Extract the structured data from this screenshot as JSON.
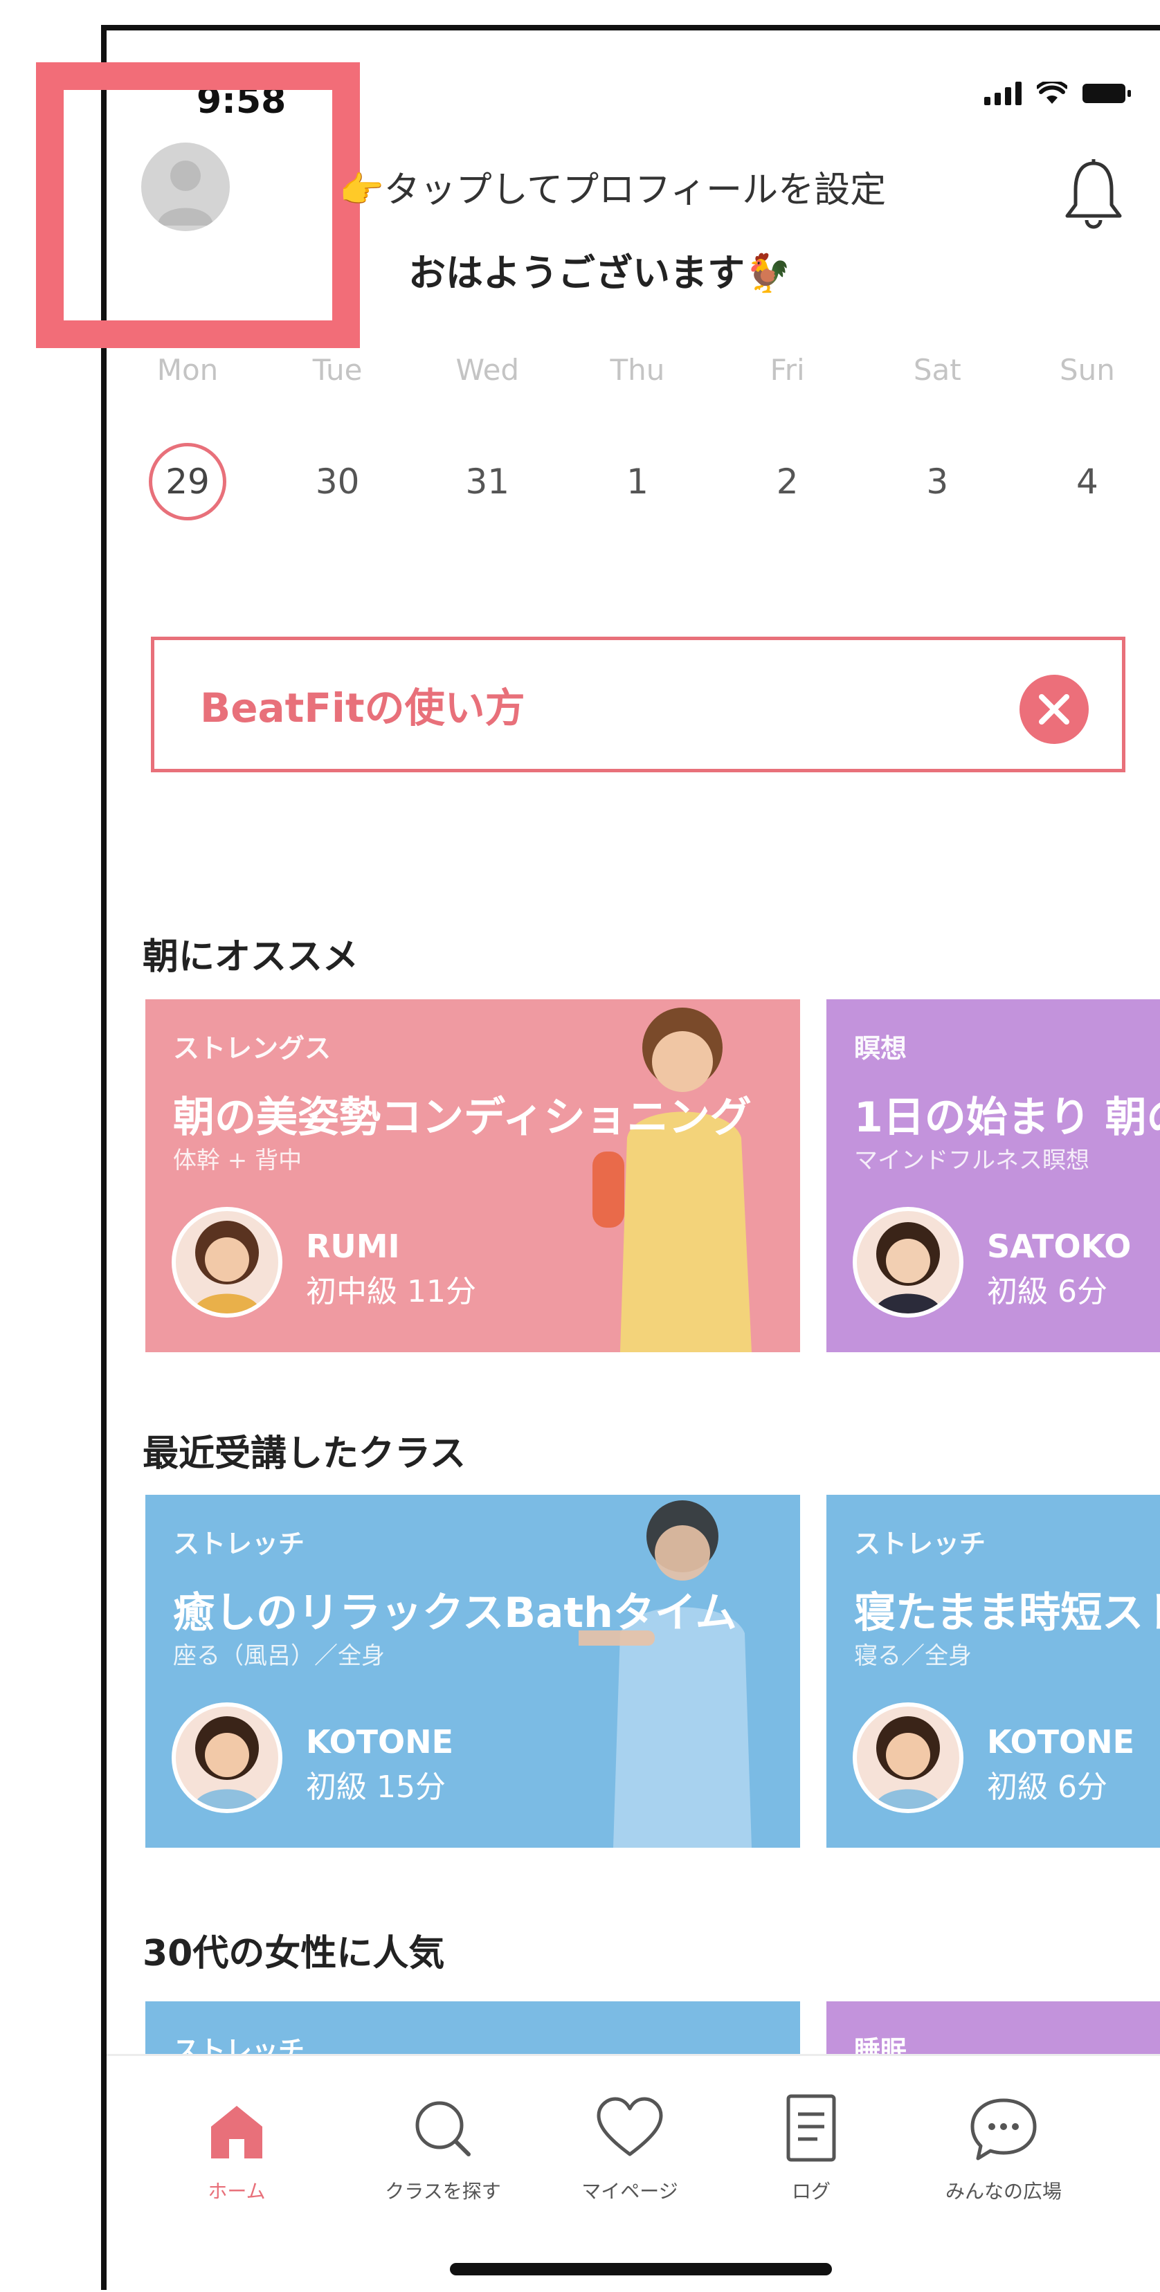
{
  "colors": {
    "accent": "#e8707a",
    "card_pink": "#ef9aa1",
    "card_purple": "#c393dc",
    "card_blue": "#7bbbe4",
    "highlight_box": "#f26d78"
  },
  "status_bar": {
    "time": "9:58",
    "icons": [
      "signal-icon",
      "wifi-icon",
      "battery-icon"
    ]
  },
  "header": {
    "profile_prompt": "👉タップしてプロフィールを設定",
    "greeting": "おはようございます🐓",
    "avatar_icon": "user-avatar-icon",
    "bell_icon": "bell-icon"
  },
  "calendar": {
    "weekdays": [
      "Mon",
      "Tue",
      "Wed",
      "Thu",
      "Fri",
      "Sat",
      "Sun"
    ],
    "dates": [
      "29",
      "30",
      "31",
      "1",
      "2",
      "3",
      "4"
    ],
    "selected": "29"
  },
  "howto_banner": {
    "text": "BeatFitの使い方"
  },
  "sections": [
    {
      "title": "朝にオススメ",
      "cards": [
        {
          "category": "ストレングス",
          "title": "朝の美姿勢コンディショニング",
          "subtitle": "体幹 + 背中",
          "instructor": "RUMI",
          "meta": "初中級 11分"
        },
        {
          "category": "瞑想",
          "title": "1日の始まり 朝の",
          "subtitle": "マインドフルネス瞑想",
          "instructor": "SATOKO",
          "meta": "初級 6分"
        }
      ]
    },
    {
      "title": "最近受講したクラス",
      "cards": [
        {
          "category": "ストレッチ",
          "title": "癒しのリラックスBathタイム",
          "subtitle": "座る（風呂）／全身",
          "instructor": "KOTONE",
          "meta": "初級 15分"
        },
        {
          "category": "ストレッチ",
          "title": "寝たまま時短スト",
          "subtitle": "寝る／全身",
          "instructor": "KOTONE",
          "meta": "初級 6分"
        }
      ]
    },
    {
      "title": "30代の女性に人気",
      "cards": [
        {
          "category": "ストレッチ"
        },
        {
          "category": "睡眠"
        }
      ]
    }
  ],
  "tabbar": {
    "tabs": [
      {
        "label": "ホーム",
        "icon": "home-icon",
        "active": true
      },
      {
        "label": "クラスを探す",
        "icon": "search-icon",
        "active": false
      },
      {
        "label": "マイページ",
        "icon": "heart-icon",
        "active": false
      },
      {
        "label": "ログ",
        "icon": "log-document-icon",
        "active": false
      },
      {
        "label": "みんなの広場",
        "icon": "chat-bubble-icon",
        "active": false
      }
    ]
  }
}
